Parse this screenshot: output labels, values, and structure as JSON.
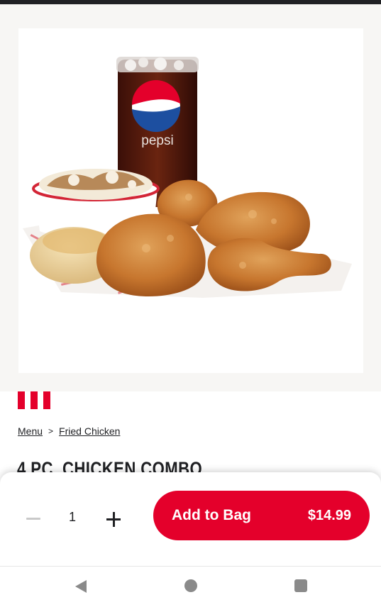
{
  "product": {
    "image_alt": "4 pc. chicken combo with Pepsi, mashed potatoes with gravy and a biscuit",
    "cup_brand": "pepsi",
    "title": "4 PC. CHICKEN COMBO"
  },
  "breadcrumb": {
    "items": [
      "Menu",
      "Fried Chicken"
    ],
    "separator": ">"
  },
  "cart": {
    "quantity": "1",
    "add_label": "Add to Bag",
    "price": "$14.99"
  },
  "colors": {
    "brand_red": "#e4002b",
    "hero_bg": "#f7f6f4",
    "text": "#202124",
    "nav_icon": "#8a8a8a"
  },
  "icons": {
    "minus": "minus-icon",
    "plus": "plus-icon",
    "nav_back": "triangle-left-icon",
    "nav_home": "circle-icon",
    "nav_recents": "square-icon"
  }
}
